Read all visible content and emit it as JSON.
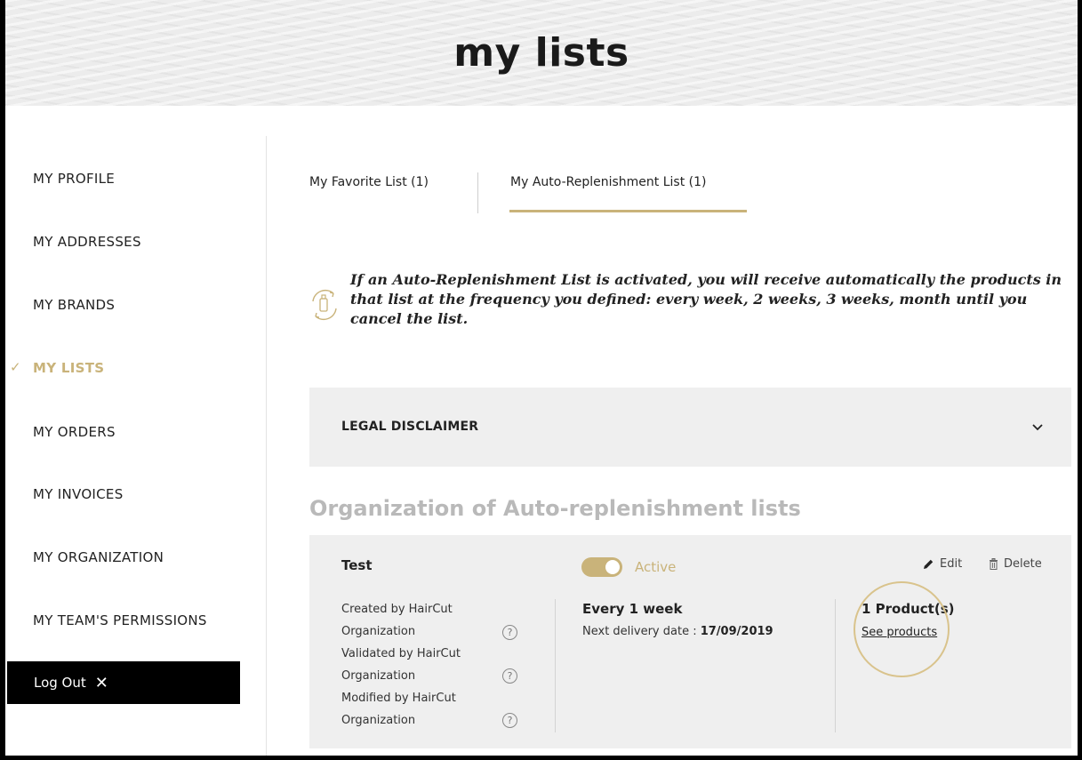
{
  "header": {
    "title": "my lists"
  },
  "sidebar": {
    "items": [
      {
        "label": "MY PROFILE"
      },
      {
        "label": "MY ADDRESSES"
      },
      {
        "label": "MY BRANDS"
      },
      {
        "label": "MY LISTS",
        "active": true
      },
      {
        "label": "MY ORDERS"
      },
      {
        "label": "MY INVOICES"
      },
      {
        "label": "MY ORGANIZATION"
      },
      {
        "label": "MY TEAM'S PERMISSIONS"
      }
    ],
    "logout_label": "Log Out",
    "logout_icon": "close-icon"
  },
  "tabs": [
    {
      "label": "My Favorite List (1)"
    },
    {
      "label": "My Auto-Replenishment List (1)",
      "active": true
    }
  ],
  "info": {
    "text": "If an Auto-Replenishment List is activated, you will receive automatically the products in that list at the frequency you defined: every week, 2 weeks, 3 weeks, month until you cancel the list.",
    "icon": "replenish-icon"
  },
  "disclaimer": {
    "label": "LEGAL DISCLAIMER",
    "icon": "chevron-down-icon"
  },
  "section": {
    "title": "Organization of Auto-replenishment lists"
  },
  "list_card": {
    "name": "Test",
    "status_label": "Active",
    "active": true,
    "edit_label": "Edit",
    "delete_label": "Delete",
    "meta": [
      "Created by HairCut",
      "Organization",
      "Validated by HairCut",
      "Organization",
      "Modified by HairCut",
      "Organization"
    ],
    "help_glyph": "?",
    "frequency": "Every 1 week",
    "next_delivery_label": "Next delivery date :",
    "next_delivery_date": "17/09/2019",
    "product_count": "1 Product(s)",
    "see_products_label": "See products"
  },
  "colors": {
    "accent": "#c9b37a",
    "panel": "#efefef",
    "muted_title": "#b9b9b9"
  }
}
